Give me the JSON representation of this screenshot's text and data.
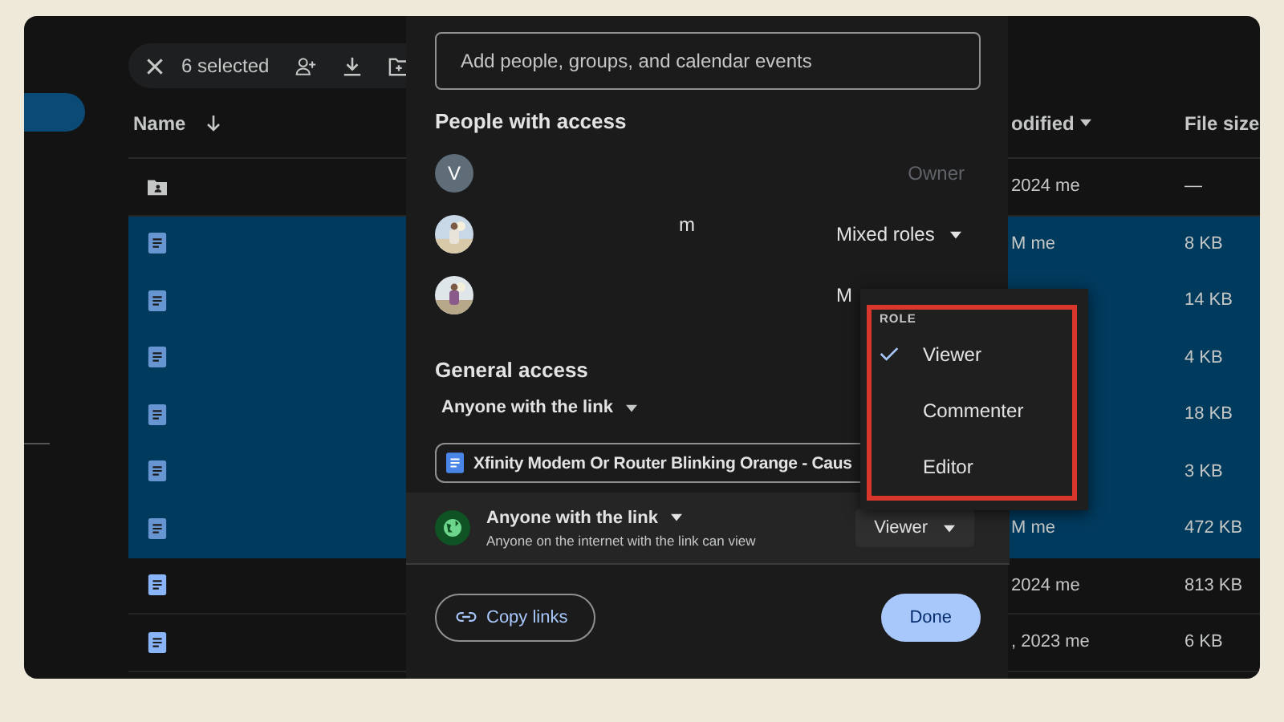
{
  "toolbar": {
    "selected_count": "6 selected"
  },
  "file_list": {
    "columns": [
      {
        "label": "Name"
      },
      {
        "label": "odified"
      },
      {
        "label": "File size"
      }
    ],
    "rows": [
      {
        "kind": "folder",
        "selected": false,
        "modified": "2024 me",
        "size": "—"
      },
      {
        "kind": "doc",
        "selected": true,
        "modified": "M me",
        "size": "8 KB"
      },
      {
        "kind": "doc",
        "selected": true,
        "size": "14 KB"
      },
      {
        "kind": "doc",
        "selected": true,
        "size": "4 KB"
      },
      {
        "kind": "doc",
        "selected": true,
        "size": "18 KB"
      },
      {
        "kind": "doc",
        "selected": true,
        "size": "3 KB"
      },
      {
        "kind": "doc",
        "selected": true,
        "modified": "M me",
        "size": "472 KB"
      },
      {
        "kind": "doc",
        "selected": false,
        "modified": "2024 me",
        "size": "813 KB"
      },
      {
        "kind": "doc",
        "selected": false,
        "modified": ", 2023 me",
        "size": "6 KB"
      }
    ]
  },
  "share_dialog": {
    "search": {
      "placeholder": "Add people, groups, and calendar events"
    },
    "people_heading": "People with access",
    "people": [
      {
        "avatar": {
          "kind": "letter",
          "letter": "V"
        },
        "role": "Owner",
        "disabled": true,
        "dropdown": false
      },
      {
        "name": "m",
        "role": "Mixed roles",
        "disabled": false,
        "dropdown": true
      },
      {
        "role": "M",
        "disabled": false
      }
    ],
    "general_heading": "General access",
    "general_select": "Anyone with the link",
    "file_chip": "Xfinity Modem Or Router Blinking Orange - Caus",
    "link_access": {
      "title": "Anyone with the link",
      "description": "Anyone on the internet with the link can view",
      "role": "Viewer"
    },
    "copy_button": "Copy links",
    "done_button": "Done"
  },
  "role_menu": {
    "heading": "ROLE",
    "items": [
      {
        "label": "Viewer",
        "selected": true
      },
      {
        "label": "Commenter",
        "selected": false
      },
      {
        "label": "Editor",
        "selected": false
      }
    ]
  }
}
